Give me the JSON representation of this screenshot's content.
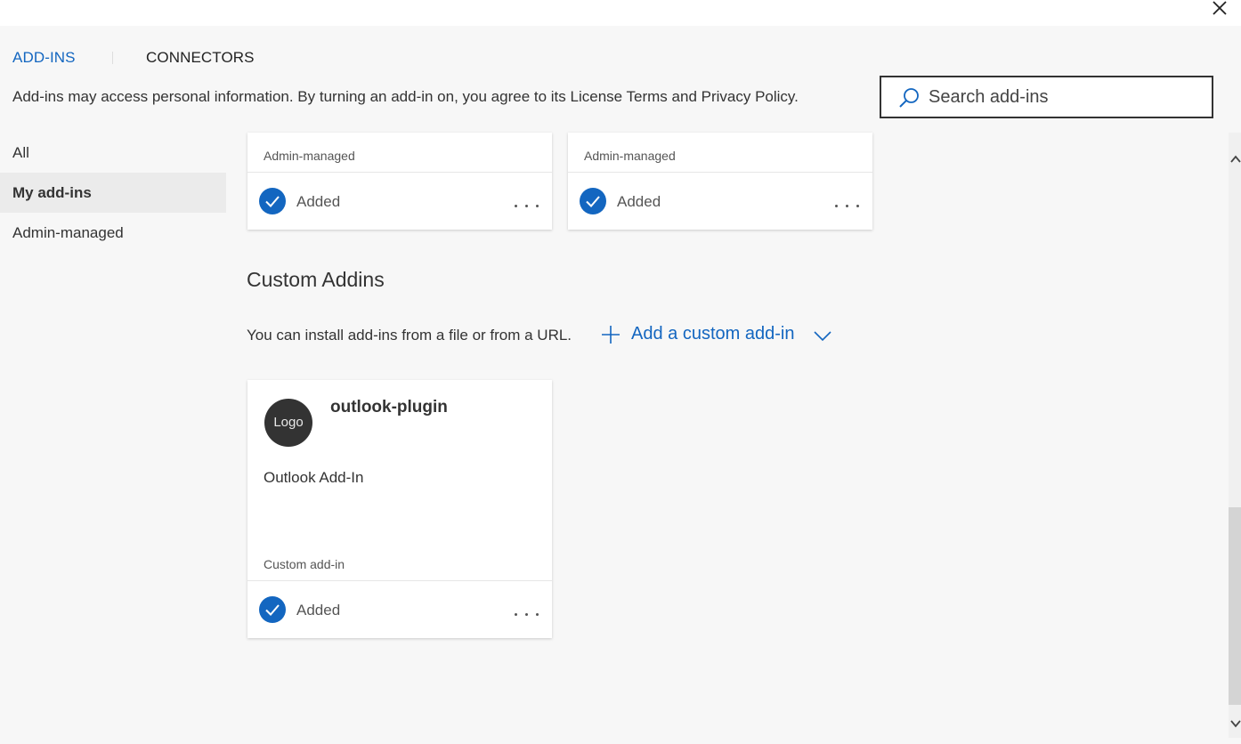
{
  "tabs": {
    "addins": "ADD-INS",
    "connectors": "CONNECTORS"
  },
  "notice": {
    "prefix": "Add-ins may access personal information. By turning an add-in on, you agree to its ",
    "license": "License Terms",
    "and": " and ",
    "privacy": "Privacy Policy",
    "suffix": "."
  },
  "search": {
    "placeholder": "Search add-ins",
    "value": ""
  },
  "sidebar": {
    "items": [
      {
        "label": "All",
        "selected": false
      },
      {
        "label": "My add-ins",
        "selected": true
      },
      {
        "label": "Admin-managed",
        "selected": false
      }
    ]
  },
  "admin_cards": [
    {
      "type_label": "Admin-managed",
      "status": "Added"
    },
    {
      "type_label": "Admin-managed",
      "status": "Added"
    }
  ],
  "custom_section": {
    "title": "Custom Addins",
    "install_text": "You can install add-ins from a file or from a URL.",
    "add_button": "Add a custom add-in"
  },
  "custom_card": {
    "logo_text": "Logo",
    "name": "outlook-plugin",
    "description": "Outlook Add-In",
    "type_label": "Custom add-in",
    "status": "Added"
  },
  "colors": {
    "accent": "#1366c0",
    "background": "#f7f7f7",
    "card": "#ffffff",
    "text": "#333333"
  },
  "icons": {
    "close": "close-icon",
    "search": "search-icon",
    "added": "checkmark-circle-icon",
    "more": "more-options-icon",
    "add": "plus-icon",
    "expand": "chevron-down-icon"
  }
}
